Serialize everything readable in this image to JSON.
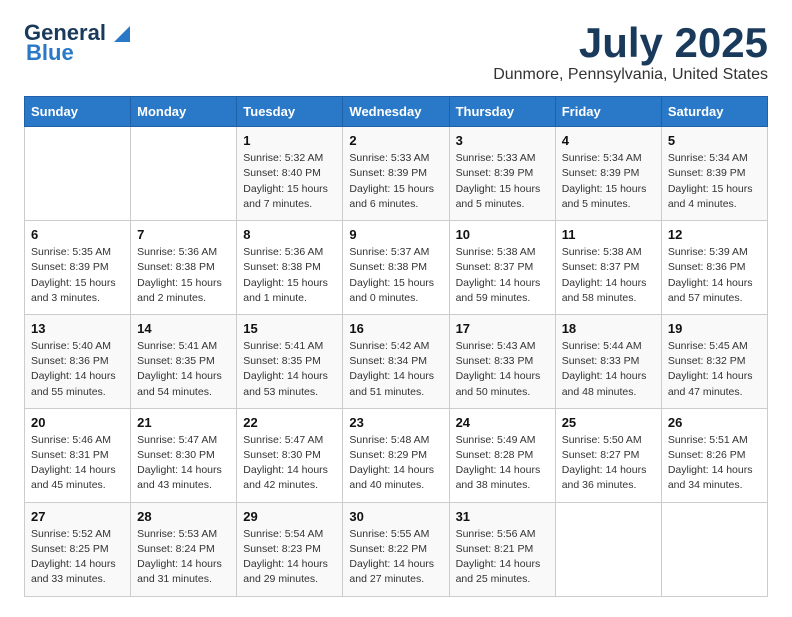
{
  "logo": {
    "line1": "General",
    "line2": "Blue"
  },
  "title": "July 2025",
  "location": "Dunmore, Pennsylvania, United States",
  "days_header": [
    "Sunday",
    "Monday",
    "Tuesday",
    "Wednesday",
    "Thursday",
    "Friday",
    "Saturday"
  ],
  "weeks": [
    [
      {
        "day": "",
        "info": ""
      },
      {
        "day": "",
        "info": ""
      },
      {
        "day": "1",
        "info": "Sunrise: 5:32 AM\nSunset: 8:40 PM\nDaylight: 15 hours and 7 minutes."
      },
      {
        "day": "2",
        "info": "Sunrise: 5:33 AM\nSunset: 8:39 PM\nDaylight: 15 hours and 6 minutes."
      },
      {
        "day": "3",
        "info": "Sunrise: 5:33 AM\nSunset: 8:39 PM\nDaylight: 15 hours and 5 minutes."
      },
      {
        "day": "4",
        "info": "Sunrise: 5:34 AM\nSunset: 8:39 PM\nDaylight: 15 hours and 5 minutes."
      },
      {
        "day": "5",
        "info": "Sunrise: 5:34 AM\nSunset: 8:39 PM\nDaylight: 15 hours and 4 minutes."
      }
    ],
    [
      {
        "day": "6",
        "info": "Sunrise: 5:35 AM\nSunset: 8:39 PM\nDaylight: 15 hours and 3 minutes."
      },
      {
        "day": "7",
        "info": "Sunrise: 5:36 AM\nSunset: 8:38 PM\nDaylight: 15 hours and 2 minutes."
      },
      {
        "day": "8",
        "info": "Sunrise: 5:36 AM\nSunset: 8:38 PM\nDaylight: 15 hours and 1 minute."
      },
      {
        "day": "9",
        "info": "Sunrise: 5:37 AM\nSunset: 8:38 PM\nDaylight: 15 hours and 0 minutes."
      },
      {
        "day": "10",
        "info": "Sunrise: 5:38 AM\nSunset: 8:37 PM\nDaylight: 14 hours and 59 minutes."
      },
      {
        "day": "11",
        "info": "Sunrise: 5:38 AM\nSunset: 8:37 PM\nDaylight: 14 hours and 58 minutes."
      },
      {
        "day": "12",
        "info": "Sunrise: 5:39 AM\nSunset: 8:36 PM\nDaylight: 14 hours and 57 minutes."
      }
    ],
    [
      {
        "day": "13",
        "info": "Sunrise: 5:40 AM\nSunset: 8:36 PM\nDaylight: 14 hours and 55 minutes."
      },
      {
        "day": "14",
        "info": "Sunrise: 5:41 AM\nSunset: 8:35 PM\nDaylight: 14 hours and 54 minutes."
      },
      {
        "day": "15",
        "info": "Sunrise: 5:41 AM\nSunset: 8:35 PM\nDaylight: 14 hours and 53 minutes."
      },
      {
        "day": "16",
        "info": "Sunrise: 5:42 AM\nSunset: 8:34 PM\nDaylight: 14 hours and 51 minutes."
      },
      {
        "day": "17",
        "info": "Sunrise: 5:43 AM\nSunset: 8:33 PM\nDaylight: 14 hours and 50 minutes."
      },
      {
        "day": "18",
        "info": "Sunrise: 5:44 AM\nSunset: 8:33 PM\nDaylight: 14 hours and 48 minutes."
      },
      {
        "day": "19",
        "info": "Sunrise: 5:45 AM\nSunset: 8:32 PM\nDaylight: 14 hours and 47 minutes."
      }
    ],
    [
      {
        "day": "20",
        "info": "Sunrise: 5:46 AM\nSunset: 8:31 PM\nDaylight: 14 hours and 45 minutes."
      },
      {
        "day": "21",
        "info": "Sunrise: 5:47 AM\nSunset: 8:30 PM\nDaylight: 14 hours and 43 minutes."
      },
      {
        "day": "22",
        "info": "Sunrise: 5:47 AM\nSunset: 8:30 PM\nDaylight: 14 hours and 42 minutes."
      },
      {
        "day": "23",
        "info": "Sunrise: 5:48 AM\nSunset: 8:29 PM\nDaylight: 14 hours and 40 minutes."
      },
      {
        "day": "24",
        "info": "Sunrise: 5:49 AM\nSunset: 8:28 PM\nDaylight: 14 hours and 38 minutes."
      },
      {
        "day": "25",
        "info": "Sunrise: 5:50 AM\nSunset: 8:27 PM\nDaylight: 14 hours and 36 minutes."
      },
      {
        "day": "26",
        "info": "Sunrise: 5:51 AM\nSunset: 8:26 PM\nDaylight: 14 hours and 34 minutes."
      }
    ],
    [
      {
        "day": "27",
        "info": "Sunrise: 5:52 AM\nSunset: 8:25 PM\nDaylight: 14 hours and 33 minutes."
      },
      {
        "day": "28",
        "info": "Sunrise: 5:53 AM\nSunset: 8:24 PM\nDaylight: 14 hours and 31 minutes."
      },
      {
        "day": "29",
        "info": "Sunrise: 5:54 AM\nSunset: 8:23 PM\nDaylight: 14 hours and 29 minutes."
      },
      {
        "day": "30",
        "info": "Sunrise: 5:55 AM\nSunset: 8:22 PM\nDaylight: 14 hours and 27 minutes."
      },
      {
        "day": "31",
        "info": "Sunrise: 5:56 AM\nSunset: 8:21 PM\nDaylight: 14 hours and 25 minutes."
      },
      {
        "day": "",
        "info": ""
      },
      {
        "day": "",
        "info": ""
      }
    ]
  ]
}
